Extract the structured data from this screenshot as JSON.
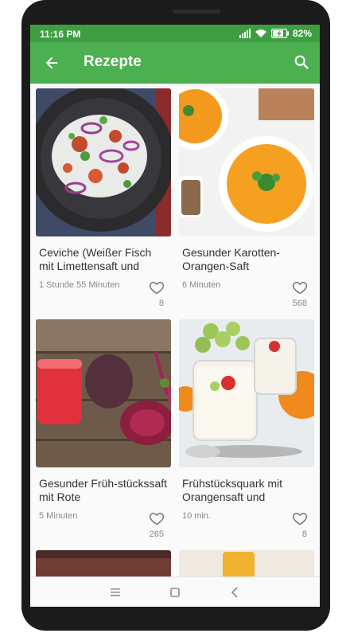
{
  "status_bar": {
    "time": "11:16 PM",
    "battery": "82%",
    "icons": [
      "signal-icon",
      "wifi-icon",
      "battery-charging-icon"
    ]
  },
  "app_bar": {
    "title": "Rezepte",
    "back_icon": "arrow-back-icon",
    "search_icon": "search-icon"
  },
  "colors": {
    "primary": "#4caf50",
    "primary_dark": "#3f9d41",
    "text": "#333333",
    "secondary_text": "#888888"
  },
  "recipes": [
    {
      "title": "Ceviche (Weißer Fisch mit Limettensaft und",
      "duration": "1 Stunde 55 Minuten",
      "likes": "8"
    },
    {
      "title": "Gesunder Karotten-Orangen-Saft",
      "duration": "6 Minuten",
      "likes": "568"
    },
    {
      "title": "Gesunder Früh-stückssaft mit Rote",
      "duration": "5 Minuten",
      "likes": "265"
    },
    {
      "title": "Frühstücksquark mit Orangensaft und",
      "duration": "10 min.",
      "likes": "8"
    }
  ],
  "nav_bar": {
    "icons": [
      "menu-icon",
      "home-square-icon",
      "back-triangle-icon"
    ]
  }
}
